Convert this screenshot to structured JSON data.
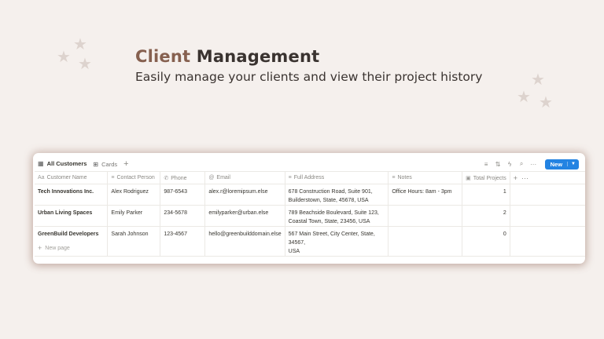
{
  "hero": {
    "title_accent": "Client",
    "title_rest": "Management",
    "subtitle": "Easily manage your clients and view their project history"
  },
  "decor": {
    "star_glyph": "★"
  },
  "database": {
    "tabs": [
      {
        "label": "All Customers",
        "icon": "table-icon",
        "active": true
      },
      {
        "label": "Cards",
        "icon": "gallery-icon",
        "active": false
      }
    ],
    "tab_add_glyph": "+",
    "toolbar": {
      "filter_icon": "filter-icon",
      "sort_icon": "sort-icon",
      "automation_icon": "lightning-icon",
      "search_icon": "search-icon",
      "more_icon": "more-icon",
      "new_label": "New",
      "new_color": "#2383e2"
    },
    "columns": [
      {
        "label": "Customer Name",
        "icon_glyph": "Aa"
      },
      {
        "label": "Contact Person",
        "icon_glyph": "≡"
      },
      {
        "label": "Phone",
        "icon_glyph": "✆"
      },
      {
        "label": "Email",
        "icon_glyph": "@"
      },
      {
        "label": "Full Address",
        "icon_glyph": "≡"
      },
      {
        "label": "Notes",
        "icon_glyph": "≡"
      },
      {
        "label": "Total Projects",
        "icon_glyph": "▣"
      }
    ],
    "add_column_glyph": "+",
    "more_column_glyph": "···",
    "rows": [
      {
        "name": "Tech Innovations Inc.",
        "contact": "Alex Rodriguez",
        "phone": "987-6543",
        "email": "alex.r@loremipsum.else",
        "address_line1": "678 Construction Road, Suite 901,",
        "address_line2": "Builderstown, State, 45678, USA",
        "notes": "Office Hours: 8am - 3pm",
        "projects": "1"
      },
      {
        "name": "Urban Living Spaces",
        "contact": "Emily Parker",
        "phone": "234-5678",
        "email": "emilyparker@urban.else",
        "address_line1": "789 Beachside Boulevard, Suite 123,",
        "address_line2": "Coastal Town, State, 23456, USA",
        "notes": "",
        "projects": "2"
      },
      {
        "name": "GreenBuild Developers",
        "contact": "Sarah Johnson",
        "phone": "123-4567",
        "email": "hello@greenbuilddomain.else",
        "address_line1": "567 Main Street, City Center, State, 34567,",
        "address_line2": "USA",
        "notes": "",
        "projects": "0"
      }
    ],
    "new_page_label": "New page",
    "new_page_glyph": "+"
  }
}
